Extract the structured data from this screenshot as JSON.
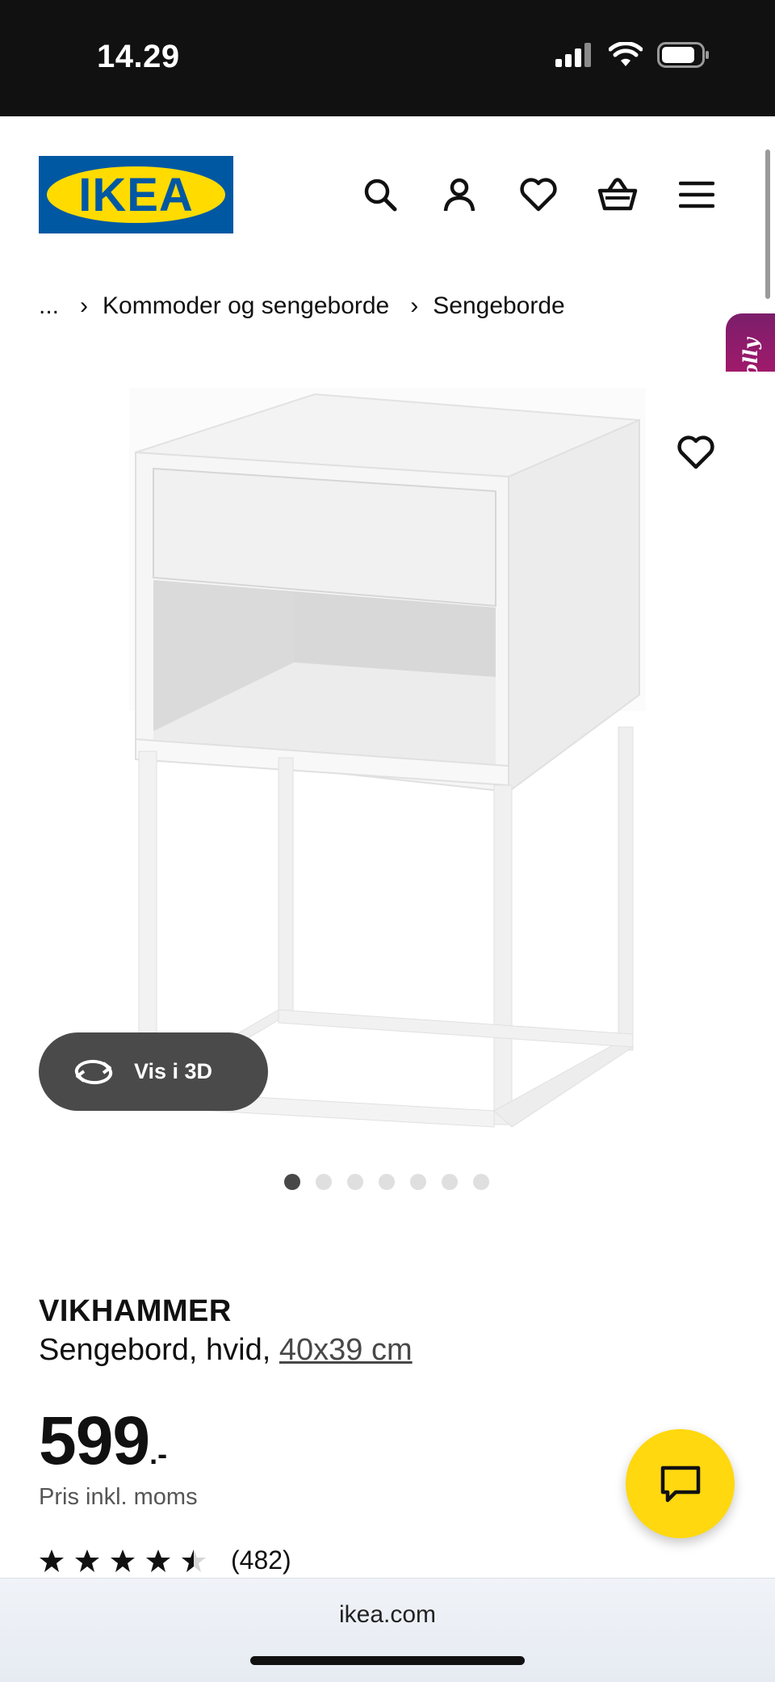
{
  "status_bar": {
    "time": "14.29"
  },
  "header": {
    "logo_text": "IKEA",
    "icons": [
      "search-icon",
      "account-icon",
      "heart-icon",
      "basket-icon",
      "menu-icon"
    ]
  },
  "breadcrumb": {
    "ellipsis": "...",
    "items": [
      "Kommoder og sengeborde",
      "Sengeborde"
    ]
  },
  "molly_label": "Molly",
  "gallery": {
    "view_3d_label": "Vis i 3D",
    "slide_count": 7,
    "active_slide": 1
  },
  "product": {
    "name": "VIKHAMMER",
    "description": "Sengebord, hvid,",
    "size": "40x39 cm",
    "price": "599",
    "price_suffix": ".-",
    "price_note": "Pris inkl. moms",
    "rating": 4.5,
    "rating_count": "(482)"
  },
  "browser": {
    "url": "ikea.com"
  },
  "colors": {
    "ikea_blue": "#0058A3",
    "ikea_yellow": "#FFDB00",
    "chat_yellow": "#FFD80F",
    "molly_magenta": "#A8186B"
  }
}
